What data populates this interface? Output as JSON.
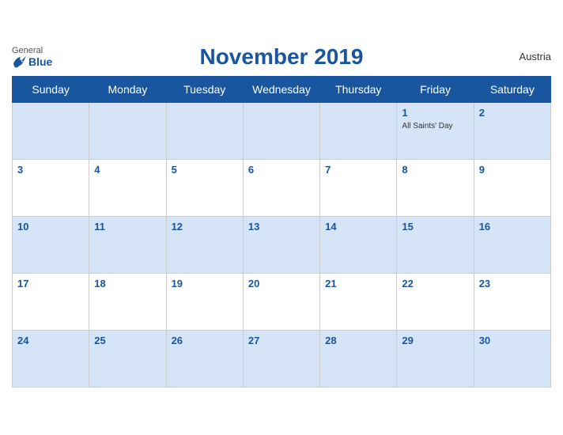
{
  "header": {
    "title": "November 2019",
    "country": "Austria",
    "logo": {
      "general": "General",
      "blue": "Blue"
    }
  },
  "weekdays": [
    "Sunday",
    "Monday",
    "Tuesday",
    "Wednesday",
    "Thursday",
    "Friday",
    "Saturday"
  ],
  "weeks": [
    [
      {
        "day": "",
        "event": ""
      },
      {
        "day": "",
        "event": ""
      },
      {
        "day": "",
        "event": ""
      },
      {
        "day": "",
        "event": ""
      },
      {
        "day": "",
        "event": ""
      },
      {
        "day": "1",
        "event": "All Saints' Day"
      },
      {
        "day": "2",
        "event": ""
      }
    ],
    [
      {
        "day": "3",
        "event": ""
      },
      {
        "day": "4",
        "event": ""
      },
      {
        "day": "5",
        "event": ""
      },
      {
        "day": "6",
        "event": ""
      },
      {
        "day": "7",
        "event": ""
      },
      {
        "day": "8",
        "event": ""
      },
      {
        "day": "9",
        "event": ""
      }
    ],
    [
      {
        "day": "10",
        "event": ""
      },
      {
        "day": "11",
        "event": ""
      },
      {
        "day": "12",
        "event": ""
      },
      {
        "day": "13",
        "event": ""
      },
      {
        "day": "14",
        "event": ""
      },
      {
        "day": "15",
        "event": ""
      },
      {
        "day": "16",
        "event": ""
      }
    ],
    [
      {
        "day": "17",
        "event": ""
      },
      {
        "day": "18",
        "event": ""
      },
      {
        "day": "19",
        "event": ""
      },
      {
        "day": "20",
        "event": ""
      },
      {
        "day": "21",
        "event": ""
      },
      {
        "day": "22",
        "event": ""
      },
      {
        "day": "23",
        "event": ""
      }
    ],
    [
      {
        "day": "24",
        "event": ""
      },
      {
        "day": "25",
        "event": ""
      },
      {
        "day": "26",
        "event": ""
      },
      {
        "day": "27",
        "event": ""
      },
      {
        "day": "28",
        "event": ""
      },
      {
        "day": "29",
        "event": ""
      },
      {
        "day": "30",
        "event": ""
      }
    ]
  ]
}
